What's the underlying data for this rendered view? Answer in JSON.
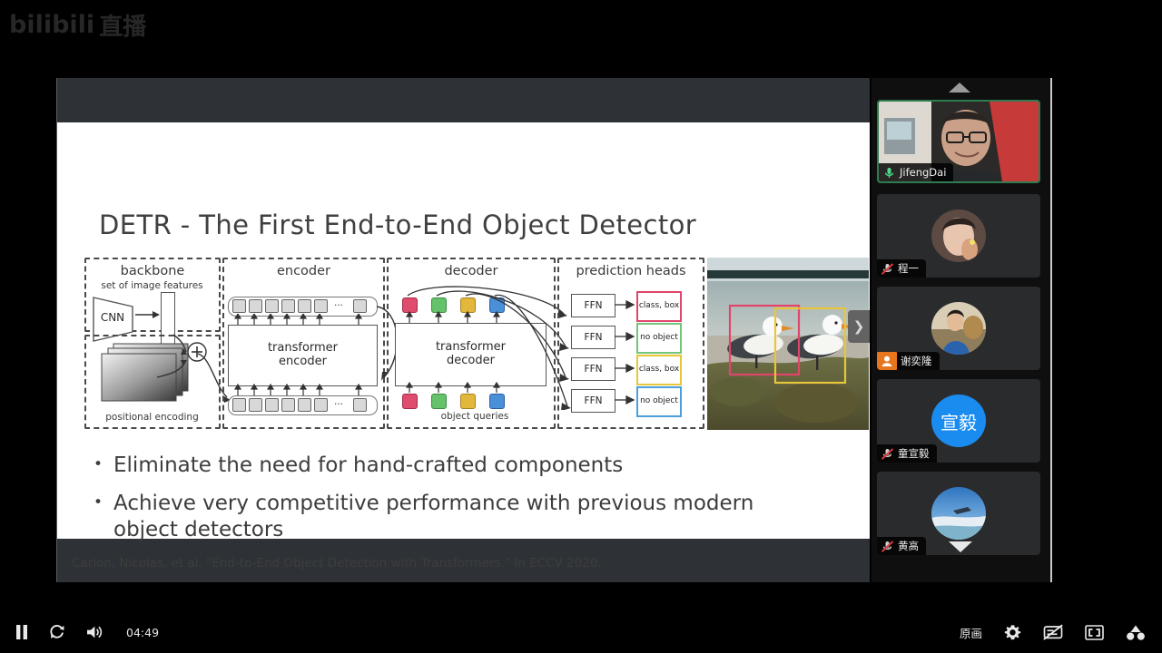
{
  "watermark": {
    "brand": "bilibili",
    "suffix": "直播"
  },
  "slide": {
    "title": "DETR - The First End-to-End Object Detector",
    "bullets": [
      "Eliminate the need for hand-crafted components",
      "Achieve very competitive performance with previous modern object detectors"
    ],
    "bullet_marker": "•",
    "citation": "Carion, Nicolas, et al. \"End-to-End Object Detection with Transformers.\" In ECCV 2020.",
    "figure": {
      "groups": [
        {
          "label": "backbone"
        },
        {
          "label": "encoder"
        },
        {
          "label": "decoder"
        },
        {
          "label": "prediction heads"
        }
      ],
      "backbone": {
        "features_label": "set of image features",
        "cnn_label": "CNN",
        "positional_label": "positional encoding",
        "plus_symbol": "+"
      },
      "encoder": {
        "block_label_line1": "transformer",
        "block_label_line2": "encoder",
        "ellipsis": "..."
      },
      "decoder": {
        "block_label_line1": "transformer",
        "block_label_line2": "decoder",
        "queries_label": "object queries",
        "query_colors": [
          "#de4d6e",
          "#64c26a",
          "#e3b63c",
          "#4a90d9"
        ]
      },
      "heads": {
        "ffn_label": "FFN",
        "predictions": [
          {
            "text": "class, box",
            "color": "#e0456b"
          },
          {
            "text": "no object",
            "color": "#74c47a"
          },
          {
            "text": "class, box",
            "color": "#e8c53b"
          },
          {
            "text": "no object",
            "color": "#4a9fe0"
          }
        ]
      },
      "photo": {
        "box_colors": [
          "#e0456b",
          "#e8c53b"
        ],
        "alt": "two seagulls on rocky shore with detection boxes"
      }
    }
  },
  "side_tab": {
    "icon": "chevron-right-icon",
    "glyph": "❯"
  },
  "participants": {
    "scroll_up_icon": "triangle-up-icon",
    "scroll_down_icon": "triangle-down-icon",
    "tiles": [
      {
        "name": "JifengDai",
        "mic": "unmuted",
        "badge": "none",
        "active_speaker": true,
        "avatar_type": "video"
      },
      {
        "name": "程一",
        "mic": "muted",
        "badge": "none",
        "active_speaker": false,
        "avatar_type": "photo"
      },
      {
        "name": "谢奕隆",
        "mic": "none",
        "badge": "host",
        "active_speaker": false,
        "avatar_type": "photo"
      },
      {
        "name": "童宣毅",
        "mic": "muted",
        "badge": "none",
        "active_speaker": false,
        "avatar_type": "initials",
        "initials": "宣毅"
      },
      {
        "name": "黄高",
        "mic": "muted",
        "badge": "none",
        "active_speaker": false,
        "avatar_type": "photo"
      }
    ]
  },
  "controls": {
    "left": [
      {
        "name": "pause-button",
        "icon": "pause-icon"
      },
      {
        "name": "refresh-button",
        "icon": "refresh-icon"
      },
      {
        "name": "volume-button",
        "icon": "volume-icon"
      }
    ],
    "time": "04:49",
    "right": [
      {
        "name": "quality-button",
        "icon": "quality-text",
        "label": "原画"
      },
      {
        "name": "settings-button",
        "icon": "gear-icon"
      },
      {
        "name": "danmaku-off-button",
        "icon": "danmaku-off-icon"
      },
      {
        "name": "fullscreen-button",
        "icon": "fullscreen-icon"
      },
      {
        "name": "web-fullscreen-button",
        "icon": "web-fullscreen-icon"
      }
    ]
  }
}
